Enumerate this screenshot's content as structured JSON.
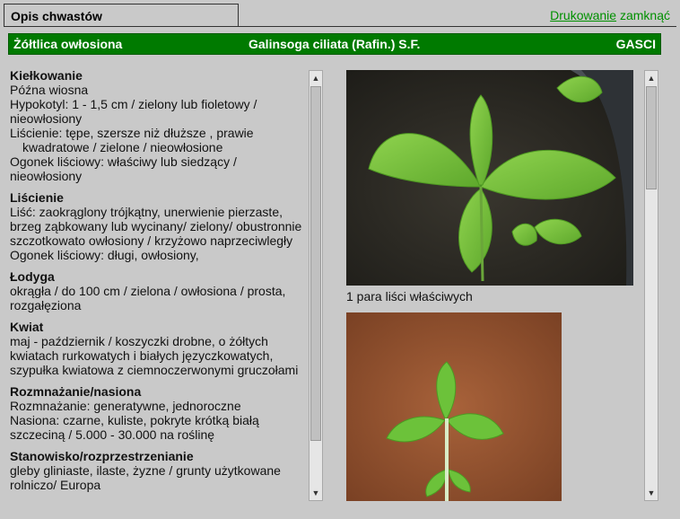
{
  "window": {
    "tab_title": "Opis chwastów"
  },
  "links": {
    "print": "Drukowanie",
    "close": "zamknąć"
  },
  "banner": {
    "name_pl": "Żółtlica owłosiona",
    "name_lat": "Galinsoga ciliata (Rafin.) S.F.",
    "code": "GASCI"
  },
  "sections": [
    {
      "title": "Kiełkowanie",
      "lines": [
        {
          "text": "Późna wiosna",
          "indent": false
        },
        {
          "text": "Hypokotyl: 1 - 1,5 cm / zielony lub fioletowy /",
          "indent": false
        },
        {
          "text": "nieowłosiony",
          "indent": false
        },
        {
          "text": "Liścienie: tępe, szersze niż dłuższe , prawie",
          "indent": false
        },
        {
          "text": "kwadratowe / zielone / nieowłosione",
          "indent": true
        },
        {
          "text": "Ogonek liściowy: właściwy lub siedzący /",
          "indent": false
        },
        {
          "text": "nieowłosiony",
          "indent": false
        }
      ]
    },
    {
      "title": "Liścienie",
      "lines": [
        {
          "text": "Liść: zaokrąglony trójkątny, unerwienie pierzaste,",
          "indent": false
        },
        {
          "text": "brzeg ząbkowany lub wycinany/ zielony/ obustronnie",
          "indent": false
        },
        {
          "text": "szczotkowato owłosiony / krzyżowo naprzeciwległy",
          "indent": false
        },
        {
          "text": "Ogonek liściowy: długi, owłosiony,",
          "indent": false
        }
      ]
    },
    {
      "title": "Łodyga",
      "lines": [
        {
          "text": "okrągła / do 100 cm / zielona / owłosiona / prosta,",
          "indent": false
        },
        {
          "text": "rozgałęziona",
          "indent": false
        }
      ]
    },
    {
      "title": "Kwiat",
      "lines": [
        {
          "text": "maj - październik / koszyczki drobne, o żółtych",
          "indent": false
        },
        {
          "text": "kwiatach rurkowatych i białych języczkowatych,",
          "indent": false
        },
        {
          "text": "szypułka kwiatowa z ciemnoczerwonymi gruczołami",
          "indent": false
        }
      ]
    },
    {
      "title": "Rozmnażanie/nasiona",
      "lines": [
        {
          "text": "Rozmnażanie: generatywne, jednoroczne",
          "indent": false
        },
        {
          "text": "Nasiona: czarne, kuliste, pokryte krótką białą",
          "indent": false
        },
        {
          "text": "szczeciną / 5.000 - 30.000 na roślinę",
          "indent": false
        }
      ]
    },
    {
      "title": "Stanowisko/rozprzestrzenianie",
      "lines": [
        {
          "text": "gleby gliniaste, ilaste, żyzne / grunty użytkowane",
          "indent": false
        },
        {
          "text": "rolniczo/ Europa",
          "indent": false
        }
      ]
    }
  ],
  "photos": {
    "caption1": "1 para liści właściwych"
  },
  "colors": {
    "banner": "#007a00",
    "link": "#009000",
    "background": "#c9c9c9"
  }
}
